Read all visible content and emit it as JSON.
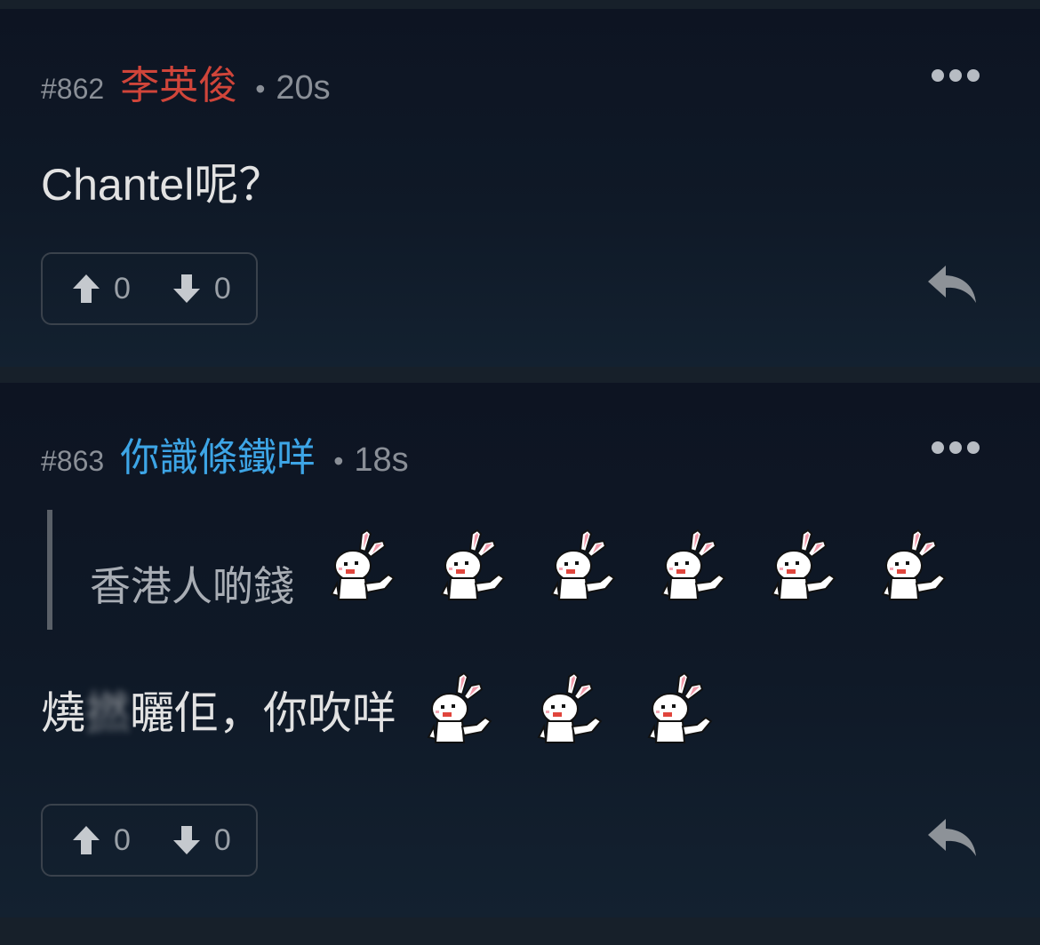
{
  "posts": [
    {
      "floor": "#862",
      "username": "李英俊",
      "username_color": "#d0453a",
      "separator": "•",
      "time_ago": "20s",
      "content": "Chantel呢？",
      "upvotes": "0",
      "downvotes": "0"
    },
    {
      "floor": "#863",
      "username": "你識條鐵咩",
      "username_color": "#3da5e6",
      "separator": "•",
      "time_ago": "18s",
      "quote_text": "香港人啲錢",
      "quote_sticker_count": 6,
      "content_before": "燒",
      "content_blurred": "撚",
      "content_after": "曬佢，你吹咩",
      "content_sticker_count": 3,
      "upvotes": "0",
      "downvotes": "0"
    }
  ],
  "icons": {
    "more": "more-options-icon",
    "upvote": "arrow-up-icon",
    "downvote": "arrow-down-icon",
    "reply": "reply-icon",
    "sticker": "rabbit-sticker-icon"
  }
}
